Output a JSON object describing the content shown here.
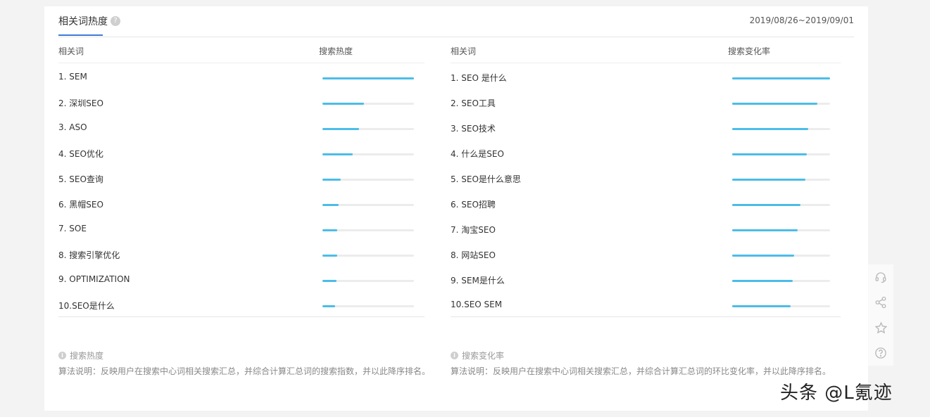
{
  "header": {
    "tab_title": "相关词热度",
    "help_mark": "?",
    "date_range": "2019/08/26~2019/09/01"
  },
  "left_panel": {
    "col_keyword": "相关词",
    "col_metric": "搜索热度",
    "rows": [
      {
        "label": "1.  SEM",
        "value": 100
      },
      {
        "label": "2.  深圳SEO",
        "value": 45
      },
      {
        "label": "3.  ASO",
        "value": 40
      },
      {
        "label": "4.  SEO优化",
        "value": 33
      },
      {
        "label": "5.  SEO查询",
        "value": 20
      },
      {
        "label": "6.  黑帽SEO",
        "value": 18
      },
      {
        "label": "7.  SOE",
        "value": 16
      },
      {
        "label": "8.  搜索引擎优化",
        "value": 16
      },
      {
        "label": "9.  OPTIMIZATION",
        "value": 15
      },
      {
        "label": "10.SEO是什么",
        "value": 14
      }
    ]
  },
  "right_panel": {
    "col_keyword": "相关词",
    "col_metric": "搜索变化率",
    "rows": [
      {
        "label": "1.  SEO 是什么",
        "value": 100
      },
      {
        "label": "2.  SEO工具",
        "value": 87
      },
      {
        "label": "3.  SEO技术",
        "value": 78
      },
      {
        "label": "4.  什么是SEO",
        "value": 76
      },
      {
        "label": "5.  SEO是什么意思",
        "value": 75
      },
      {
        "label": "6.  SEO招聘",
        "value": 70
      },
      {
        "label": "7.  淘宝SEO",
        "value": 67
      },
      {
        "label": "8.  网站SEO",
        "value": 63
      },
      {
        "label": "9.  SEM是什么",
        "value": 62
      },
      {
        "label": "10.SEO SEM",
        "value": 60
      }
    ]
  },
  "notes": {
    "left_title": "搜索热度",
    "left_text": "算法说明：反映用户在搜索中心词相关搜索汇总，并综合计算汇总词的搜索指数，并以此降序排名。",
    "right_title": "搜索变化率",
    "right_text": "算法说明：反映用户在搜索中心词相关搜索汇总，并综合计算汇总词的环比变化率，并以此降序排名。",
    "info_mark": "i"
  },
  "sidebar": {
    "icons": [
      "headset-icon",
      "share-icon",
      "star-icon",
      "help-circle-icon"
    ]
  },
  "watermark": "头条 @L氪迹",
  "colors": {
    "bar_fill": "#4bbde8",
    "bar_track": "#ececec",
    "tab_accent": "#3b7bd6"
  }
}
